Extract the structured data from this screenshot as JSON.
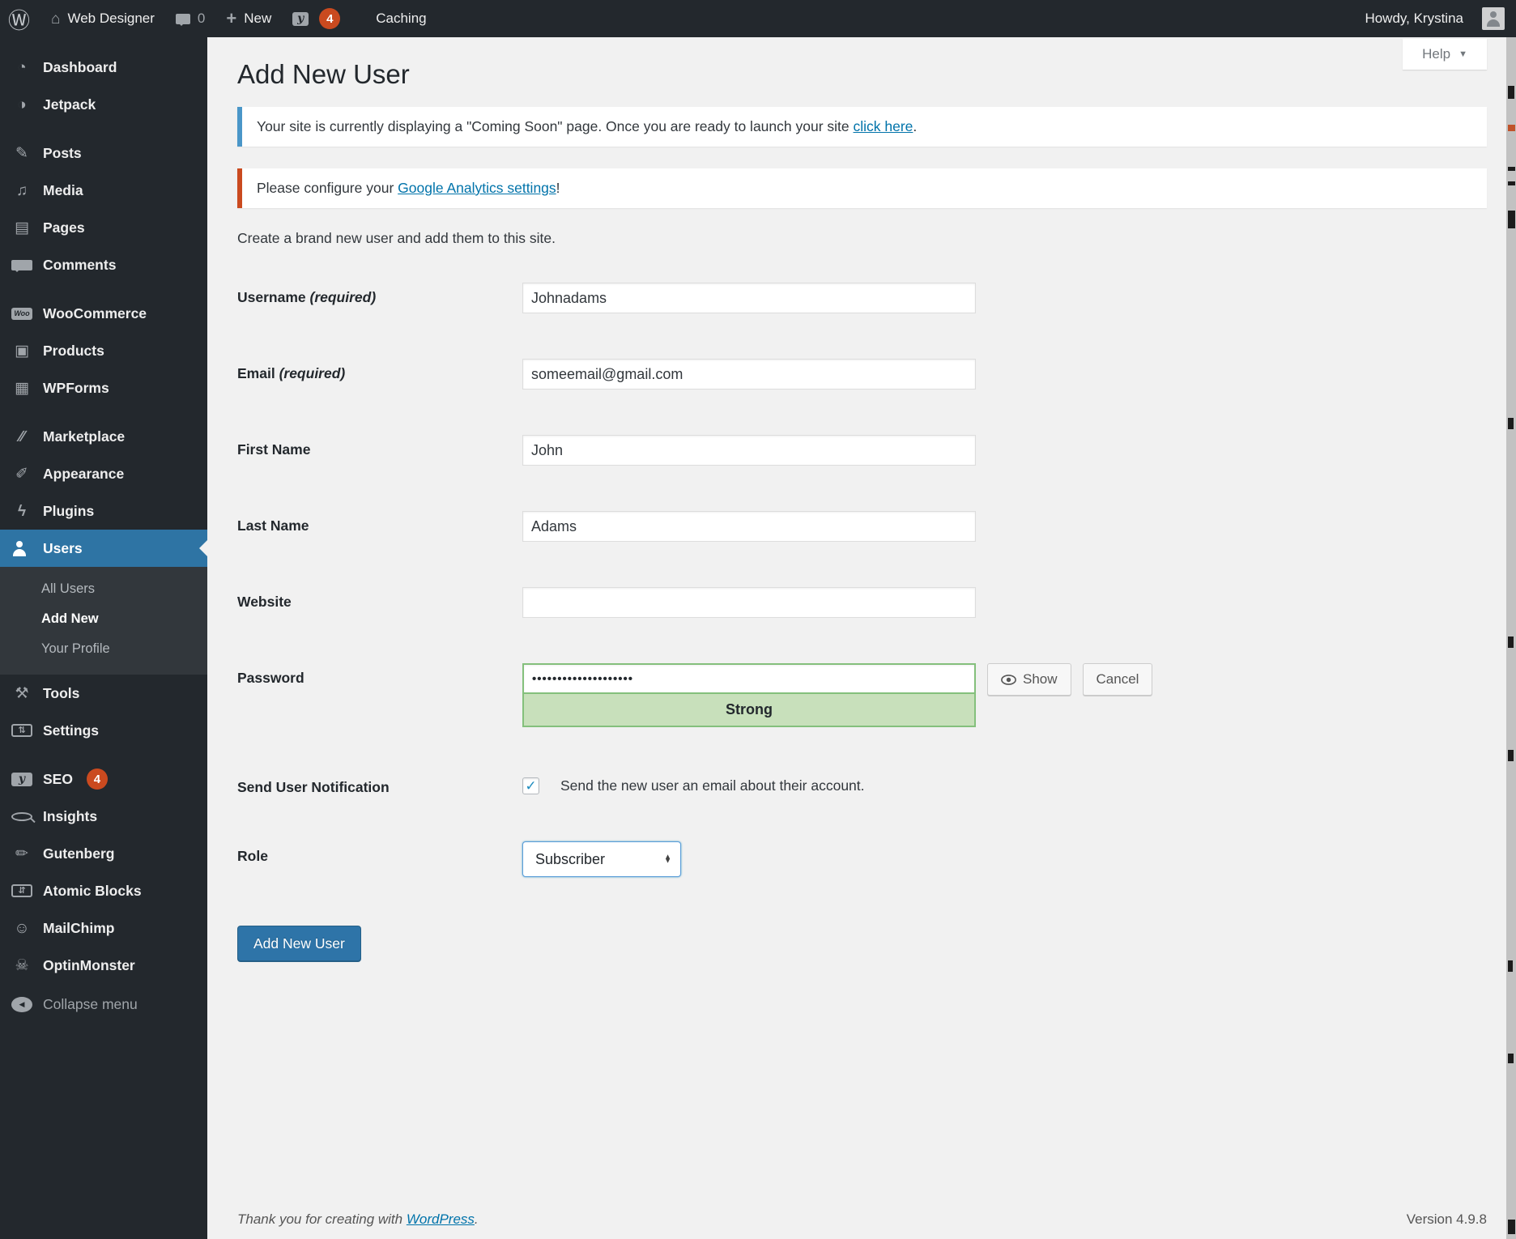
{
  "admin_bar": {
    "site_name": "Web Designer",
    "comment_count": "0",
    "new_label": "New",
    "seo_badge": "4",
    "caching_label": "Caching",
    "howdy": "Howdy, Krystina"
  },
  "sidebar": {
    "items": [
      {
        "id": "dashboard",
        "label": "Dashboard",
        "icon": "dashboard-icon"
      },
      {
        "id": "jetpack",
        "label": "Jetpack",
        "icon": "jetpack-icon",
        "gap_after": true
      },
      {
        "id": "posts",
        "label": "Posts",
        "icon": "posts-icon"
      },
      {
        "id": "media",
        "label": "Media",
        "icon": "media-icon"
      },
      {
        "id": "pages",
        "label": "Pages",
        "icon": "pages-icon"
      },
      {
        "id": "comments",
        "label": "Comments",
        "icon": "comments-icon",
        "gap_after": true
      },
      {
        "id": "woocommerce",
        "label": "WooCommerce",
        "icon": "woocommerce-icon"
      },
      {
        "id": "products",
        "label": "Products",
        "icon": "products-icon"
      },
      {
        "id": "wpforms",
        "label": "WPForms",
        "icon": "wpforms-icon",
        "gap_after": true
      },
      {
        "id": "marketplace",
        "label": "Marketplace",
        "icon": "marketplace-icon"
      },
      {
        "id": "appearance",
        "label": "Appearance",
        "icon": "appearance-icon"
      },
      {
        "id": "plugins",
        "label": "Plugins",
        "icon": "plugins-icon"
      },
      {
        "id": "users",
        "label": "Users",
        "icon": "users-icon",
        "active": true,
        "submenu": [
          {
            "id": "all-users",
            "label": "All Users"
          },
          {
            "id": "add-new",
            "label": "Add New",
            "current": true
          },
          {
            "id": "your-profile",
            "label": "Your Profile"
          }
        ]
      },
      {
        "id": "tools",
        "label": "Tools",
        "icon": "tools-icon"
      },
      {
        "id": "settings",
        "label": "Settings",
        "icon": "settings-icon",
        "gap_after": true
      },
      {
        "id": "seo",
        "label": "SEO",
        "icon": "seo-icon",
        "badge": "4"
      },
      {
        "id": "insights",
        "label": "Insights",
        "icon": "insights-icon"
      },
      {
        "id": "gutenberg",
        "label": "Gutenberg",
        "icon": "gutenberg-icon"
      },
      {
        "id": "atomic-blocks",
        "label": "Atomic Blocks",
        "icon": "atomic-blocks-icon"
      },
      {
        "id": "mailchimp",
        "label": "MailChimp",
        "icon": "mailchimp-icon"
      },
      {
        "id": "optinmonster",
        "label": "OptinMonster",
        "icon": "optinmonster-icon"
      }
    ],
    "collapse": {
      "id": "collapse-menu",
      "label": "Collapse menu",
      "icon": "collapse-menu-icon"
    }
  },
  "page": {
    "title": "Add New User",
    "help_label": "Help",
    "intro": "Create a brand new user and add them to this site."
  },
  "notices": [
    {
      "text": "Your site is currently displaying a \"Coming Soon\" page. Once you are ready to launch your site ",
      "link": "click here",
      "suffix": "."
    },
    {
      "text": "Please configure your ",
      "link": "Google Analytics settings",
      "suffix": "!"
    }
  ],
  "form": {
    "fields": [
      {
        "id": "username",
        "label": "Username",
        "required": "(required)",
        "value": "Johnadams"
      },
      {
        "id": "email",
        "label": "Email",
        "required": "(required)",
        "value": "someemail@gmail.com"
      },
      {
        "id": "first-name",
        "label": "First Name",
        "value": "John"
      },
      {
        "id": "last-name",
        "label": "Last Name",
        "value": "Adams"
      },
      {
        "id": "website",
        "label": "Website",
        "value": ""
      }
    ],
    "password": {
      "label": "Password",
      "value": "••••••••••••••••••••",
      "strength": "Strong",
      "show_label": "Show",
      "cancel_label": "Cancel"
    },
    "notification": {
      "label": "Send User Notification",
      "checkbox_text": "Send the new user an email about their account.",
      "checked": true
    },
    "role": {
      "label": "Role",
      "value": "Subscriber"
    },
    "submit_label": "Add New User"
  },
  "footer": {
    "thanks_text": "Thank you for creating with ",
    "thanks_link": "WordPress",
    "thanks_suffix": ".",
    "version": "Version 4.9.8"
  },
  "colors": {
    "sidebar_bg": "#23282d",
    "active_blue": "#2e74a4",
    "notice_info_accent": "#4a96c8",
    "notice_warn_accent": "#ca4a1f",
    "badge_red": "#ca4a1f",
    "button_primary": "#2e74a8",
    "strength_strong_bg": "#c8e0bb",
    "strength_strong_border": "#84c07c",
    "link_blue": "#0073aa",
    "check_blue": "#1e8cbe"
  }
}
